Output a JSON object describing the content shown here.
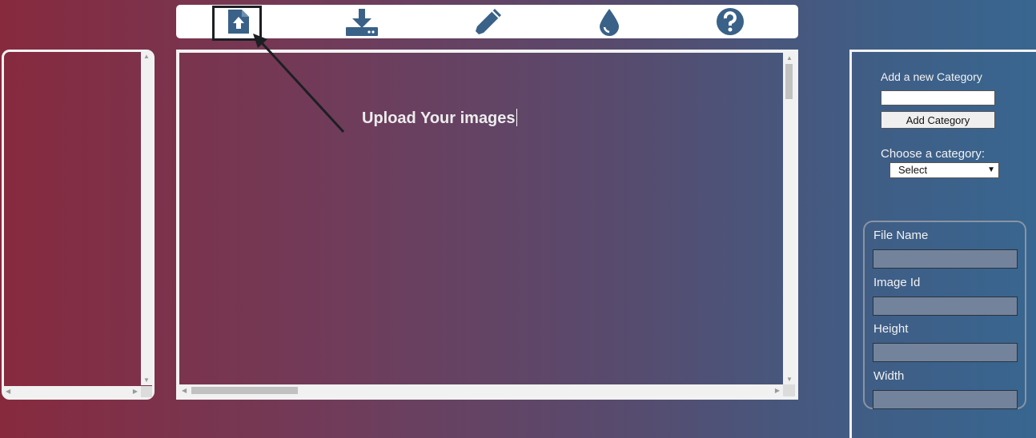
{
  "toolbar": {
    "tools": [
      {
        "name": "upload-file-icon",
        "label": ""
      },
      {
        "name": "download-icon",
        "label": ""
      },
      {
        "name": "pencil-icon",
        "label": ""
      },
      {
        "name": "drop-icon",
        "label": ""
      },
      {
        "name": "help-icon",
        "label": ""
      }
    ],
    "icon_color": "#3a6188"
  },
  "main": {
    "upload_text": "Upload Your images"
  },
  "sidebar": {
    "add_category_label": "Add a new Category",
    "add_category_input_value": "",
    "add_category_button": "Add Category",
    "choose_category_label": "Choose a category:",
    "category_select_value": "Select",
    "fields": [
      {
        "label": "File Name",
        "value": ""
      },
      {
        "label": "Image Id",
        "value": ""
      },
      {
        "label": "Height",
        "value": ""
      },
      {
        "label": "Width",
        "value": ""
      }
    ]
  },
  "colors": {
    "gradient_left": "#872a3e",
    "gradient_right": "#386690",
    "field_bg": "#73839c"
  }
}
